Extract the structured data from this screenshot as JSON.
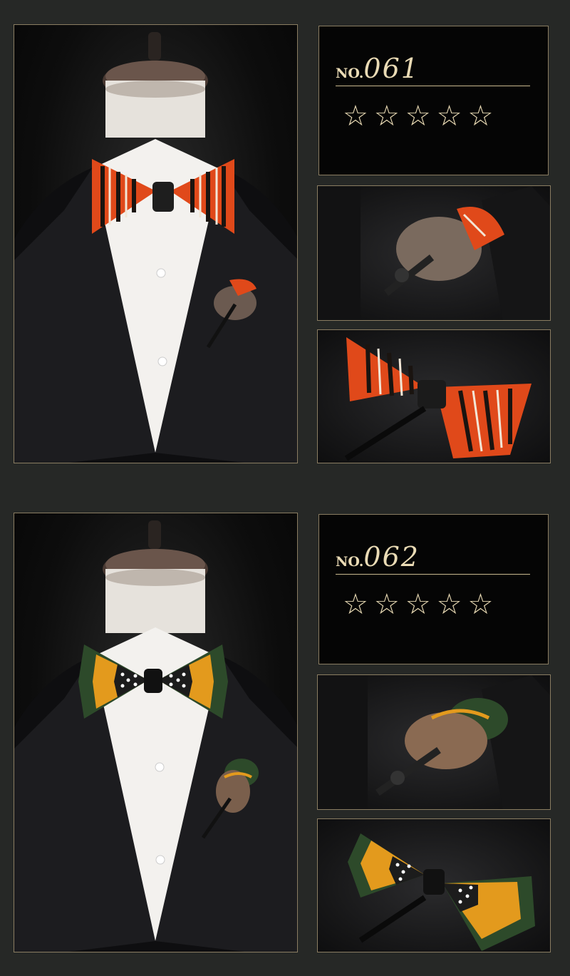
{
  "products": [
    {
      "number_prefix": "NO.",
      "number": "061",
      "rating_stars": 5,
      "stars_text": "☆☆☆☆☆",
      "colors": {
        "feather_main": "#e0491a",
        "feather_stripe": "#1a1410",
        "feather_light": "#f2e6d6",
        "accent": "#c9b98f"
      }
    },
    {
      "number_prefix": "NO.",
      "number": "062",
      "rating_stars": 5,
      "stars_text": "☆☆☆☆☆",
      "colors": {
        "feather_main": "#e39a1d",
        "feather_stripe": "#2d4a2a",
        "feather_light": "#ffffff",
        "accent": "#c9b98f"
      }
    }
  ],
  "icons": [
    "mannequin-icon",
    "bow-tie-icon",
    "lapel-pin-icon",
    "star-icon"
  ]
}
